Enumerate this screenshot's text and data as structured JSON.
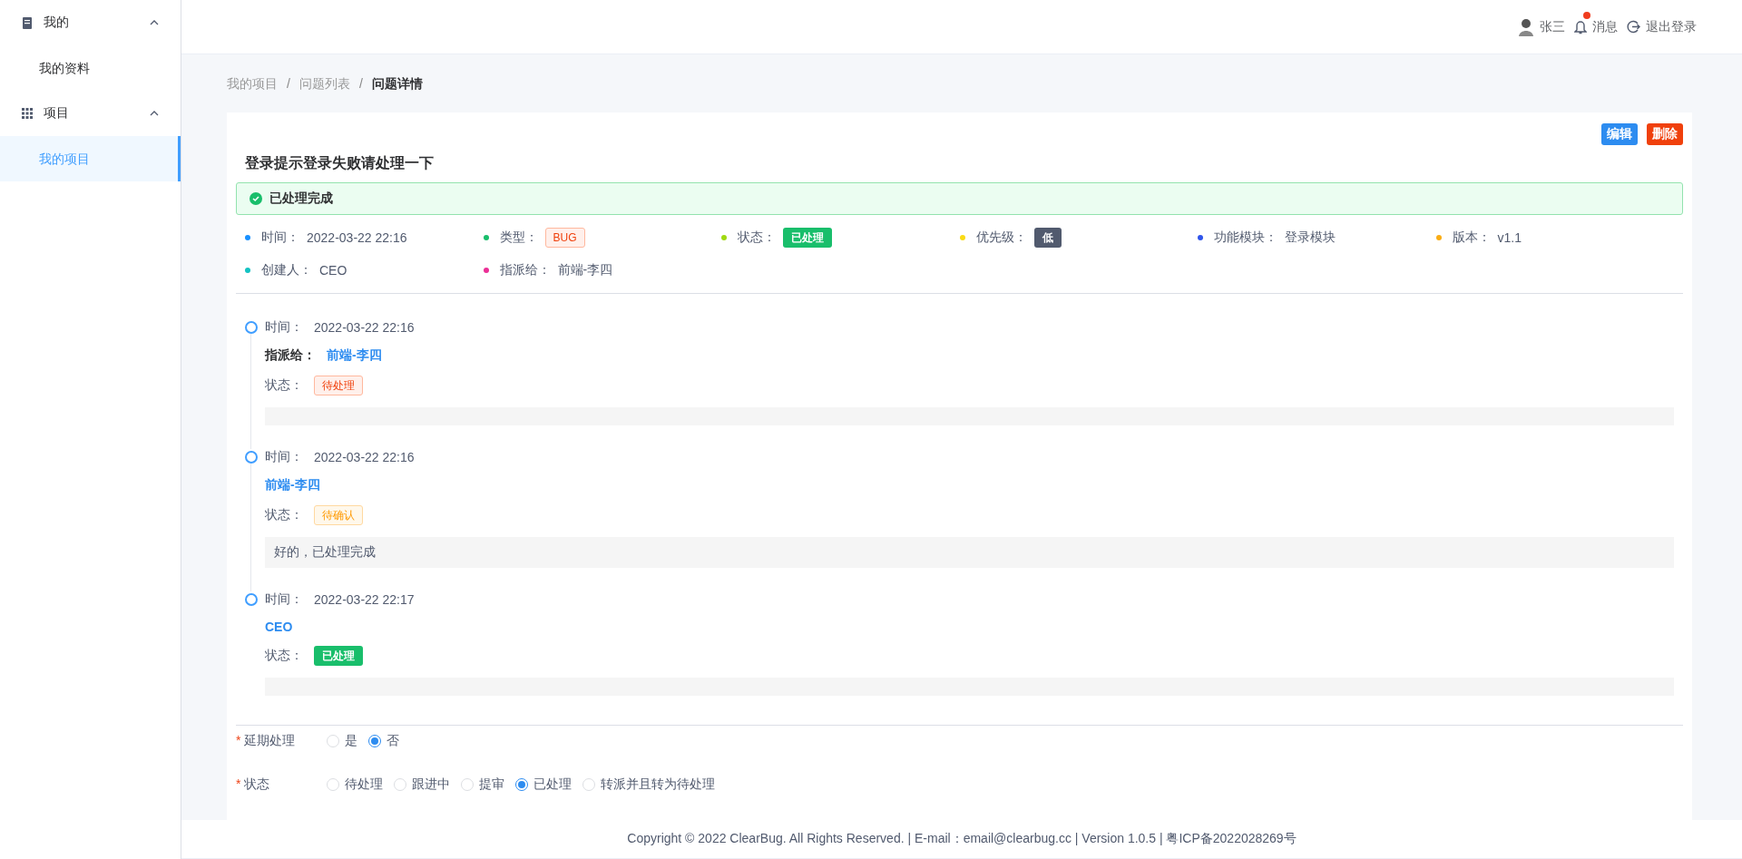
{
  "sidebar": {
    "groups": [
      {
        "title": "我的",
        "expanded": true,
        "items": [
          {
            "label": "我的资料",
            "selected": false
          }
        ]
      },
      {
        "title": "项目",
        "expanded": true,
        "items": [
          {
            "label": "我的项目",
            "selected": true
          }
        ]
      }
    ]
  },
  "header": {
    "user": "张三",
    "messages": {
      "label": "消息",
      "unread": true
    },
    "logout": "退出登录"
  },
  "breadcrumb": [
    {
      "label": "我的项目",
      "current": false
    },
    {
      "separator": "/",
      "label": "问题列表",
      "current": false
    },
    {
      "separator": "/",
      "label": "问题详情",
      "current": true
    }
  ],
  "actions": [
    {
      "label": "编辑",
      "kind": "primary"
    },
    {
      "label": "删除",
      "kind": "danger"
    }
  ],
  "issue": {
    "title": "登录提示登录失败请处理一下",
    "alert": "已处理完成"
  },
  "meta": [
    {
      "label": "时间：",
      "value": "2022-03-22 22:16",
      "color": "#1890ff"
    },
    {
      "label": "类型：",
      "tag": {
        "text": "BUG",
        "kind": "danger-plain"
      },
      "color": "#19be6b"
    },
    {
      "label": "状态：",
      "tag": {
        "text": "已处理",
        "kind": "success"
      },
      "color": "#a0d911"
    },
    {
      "label": "优先级：",
      "tag": {
        "text": "低",
        "kind": "dark"
      },
      "color": "#fadb14"
    },
    {
      "label": "功能模块：",
      "value": "登录模块",
      "color": "#2f54eb"
    },
    {
      "label": "版本：",
      "value": "v1.1",
      "color": "#faad14"
    },
    {
      "label": "创建人：",
      "value": "CEO",
      "color": "#13c2c2"
    },
    {
      "label": "指派给：",
      "value": "前端-李四",
      "color": "#eb2f96"
    }
  ],
  "timeline": [
    {
      "time_label": "时间：",
      "time": "2022-03-22 22:16",
      "person_label": "指派给：",
      "person": "前端-李四",
      "status_label": "状态：",
      "status": {
        "text": "待处理",
        "kind": "danger-plain"
      }
    },
    {
      "time_label": "时间：",
      "time": "2022-03-22 22:16",
      "person": "前端-李四",
      "status_label": "状态：",
      "status": {
        "text": "待确认",
        "kind": "warning-plain"
      },
      "comment": "好的，已处理完成"
    },
    {
      "time_label": "时间：",
      "time": "2022-03-22 22:17",
      "person": "CEO",
      "status_label": "状态：",
      "status": {
        "text": "已处理",
        "kind": "success"
      }
    }
  ],
  "form": [
    {
      "label": "延期处理",
      "required_mark": "*",
      "options": [
        {
          "label": "是",
          "selected": false
        },
        {
          "label": "否",
          "selected": true
        }
      ]
    },
    {
      "label": "状态",
      "required_mark": "*",
      "options": [
        {
          "label": "待处理",
          "selected": false
        },
        {
          "label": "跟进中",
          "selected": false
        },
        {
          "label": "提审",
          "selected": false
        },
        {
          "label": "已处理",
          "selected": true
        },
        {
          "label": "转派并且转为待处理",
          "selected": false
        }
      ]
    }
  ],
  "footer": "Copyright © 2022 ClearBug. All Rights Reserved. | E-mail：email@clearbug.cc | Version 1.0.5 | 粤ICP备2022028269号"
}
